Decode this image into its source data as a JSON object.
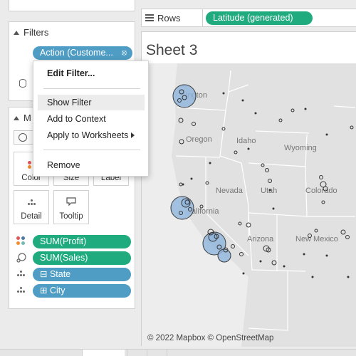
{
  "filters": {
    "title": "Filters",
    "action_pill": "Action (Custome...",
    "link_symbol": "⦻"
  },
  "marks": {
    "title": "M",
    "buttons": {
      "color": "Color",
      "size": "Size",
      "label": "Label",
      "detail": "Detail",
      "tooltip": "Tooltip"
    },
    "fields": [
      {
        "label": "SUM(Profit)",
        "type": "measure",
        "color": "#1fab7e"
      },
      {
        "label": "SUM(Sales)",
        "type": "measure",
        "color": "#1fab7e"
      },
      {
        "label": "⊟ State",
        "type": "dimension",
        "color": "#4f9dc4"
      },
      {
        "label": "⊞ City",
        "type": "dimension",
        "color": "#4f9dc4"
      }
    ]
  },
  "rows": {
    "label": "Rows",
    "pill": "Latitude (generated)"
  },
  "sheet": {
    "title": "Sheet 3"
  },
  "map": {
    "state_labels": [
      "ington",
      "Idaho",
      "Oregon",
      "Wyoming",
      "Nevada",
      "Utah",
      "Colorado",
      "alifornia",
      "Arizona",
      "New Mexico"
    ],
    "attribution": "© 2022 Mapbox © OpenStreetMap"
  },
  "context_menu": {
    "items": [
      "Edit Filter...",
      "Show Filter",
      "Add to Context",
      "Apply to Worksheets",
      "Remove"
    ],
    "highlighted": "Show Filter"
  },
  "colors": {
    "measure": "#1fab7e",
    "dimension": "#4f9dc4",
    "circle_fill": "#8fb4dc",
    "map_bg": "#e1e1e1"
  }
}
